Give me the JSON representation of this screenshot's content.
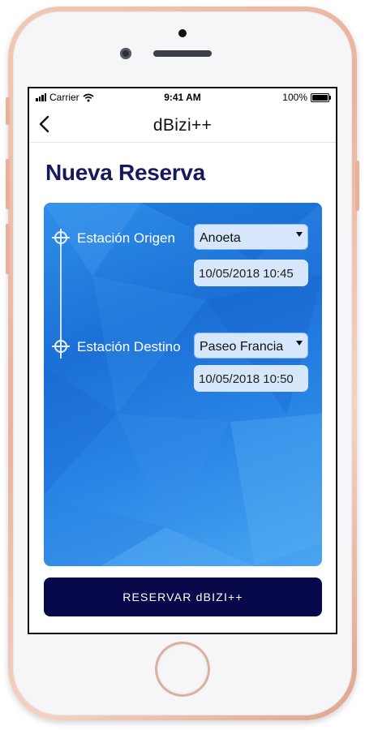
{
  "status_bar": {
    "carrier": "Carrier",
    "time": "9:41 AM",
    "battery": "100%"
  },
  "nav": {
    "title": "dBizi++",
    "back_icon": "chevron-left-icon"
  },
  "page": {
    "title": "Nueva Reserva"
  },
  "origin": {
    "label": "Estación Origen",
    "station": "Anoeta",
    "datetime": "10/05/2018 10:45"
  },
  "destination": {
    "label": "Estación Destino",
    "station": "Paseo Francia",
    "datetime": "10/05/2018 10:50"
  },
  "reserve_button": {
    "label": "RESERVAR dBIZI++"
  },
  "colors": {
    "title": "#141a5c",
    "card": "#1b6fd6",
    "button": "#08094a",
    "field": "#d6e6fb",
    "phone_frame": "#e9b39f"
  }
}
